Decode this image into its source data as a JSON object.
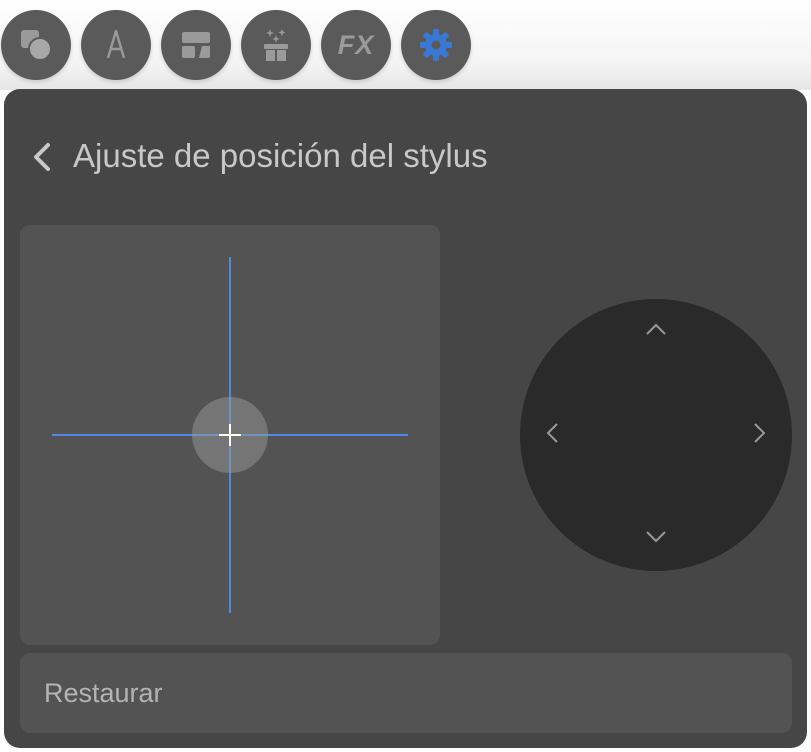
{
  "toolbar": {
    "tools": [
      {
        "icon": "shapes-icon"
      },
      {
        "icon": "text-icon"
      },
      {
        "icon": "frame-icon"
      },
      {
        "icon": "gift-effects-icon"
      },
      {
        "icon": "fx-icon",
        "label": "FX"
      },
      {
        "icon": "gear-icon",
        "active": true
      }
    ],
    "active_color": "#3a78d6",
    "icon_color": "#9a9a9a"
  },
  "panel": {
    "title": "Ajuste de posición del stylus",
    "back_icon": "chevron-left-icon",
    "restore_label": "Restaurar",
    "crosshair_color": "#4f8ae0"
  }
}
